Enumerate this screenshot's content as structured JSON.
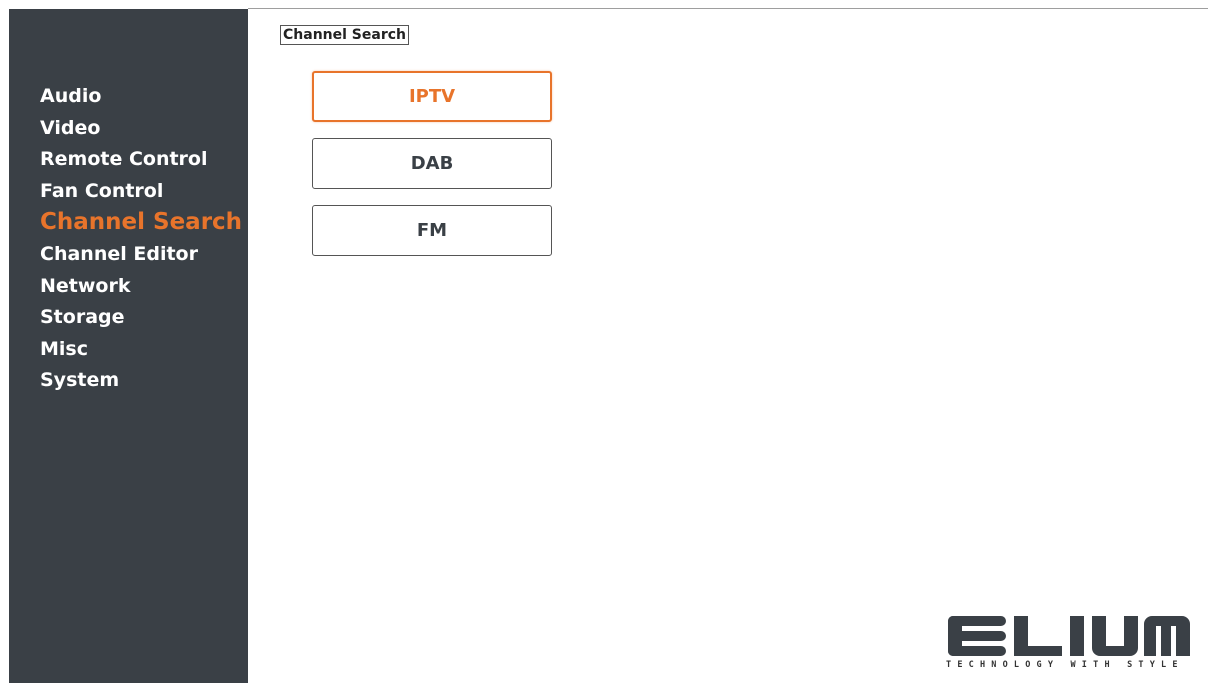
{
  "sidebar": {
    "items": [
      {
        "label": "Audio",
        "active": false
      },
      {
        "label": "Video",
        "active": false
      },
      {
        "label": "Remote Control",
        "active": false
      },
      {
        "label": "Fan Control",
        "active": false
      },
      {
        "label": "Channel Search",
        "active": true
      },
      {
        "label": "Channel Editor",
        "active": false
      },
      {
        "label": "Network",
        "active": false
      },
      {
        "label": "Storage",
        "active": false
      },
      {
        "label": "Misc",
        "active": false
      },
      {
        "label": "System",
        "active": false
      }
    ]
  },
  "main": {
    "title": "Channel Search",
    "buttons": [
      {
        "label": "IPTV",
        "focused": true
      },
      {
        "label": "DAB",
        "focused": false
      },
      {
        "label": "FM",
        "focused": false
      }
    ]
  },
  "brand": {
    "name": "ELIUM",
    "tagline": "TECHNOLOGY WITH STYLE"
  },
  "colors": {
    "accent": "#e8742b",
    "sidebar_bg": "#3a4046",
    "text_light": "#ffffff",
    "text_dark": "#3a4046"
  }
}
